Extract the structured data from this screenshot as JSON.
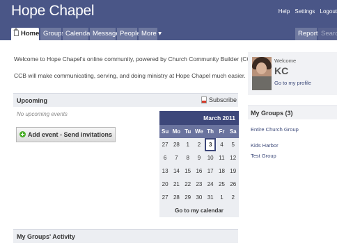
{
  "header": {
    "app_title": "Hope Chapel",
    "util_links": [
      "Help",
      "Settings",
      "Logout"
    ]
  },
  "nav": {
    "home": "Home",
    "groups": "Groups",
    "calendar": "Calendar",
    "messages": "Messages",
    "people": "People",
    "more": "More ▾",
    "reports": "Reports",
    "search": "Search"
  },
  "intro": {
    "line1": "Welcome to Hope Chapel's online community, powered by Church Community Builder (CCB)!",
    "line2": "CCB will make communicating, serving, and doing ministry at Hope Chapel much easier."
  },
  "upcoming": {
    "title": "Upcoming",
    "subscribe": "Subscribe",
    "empty": "No upcoming events",
    "add_event": "Add event - Send invitations"
  },
  "calendar": {
    "month": "March 2011",
    "dows": [
      "Su",
      "Mo",
      "Tu",
      "We",
      "Th",
      "Fr",
      "Sa"
    ],
    "weeks": [
      [
        "27",
        "28",
        "1",
        "2",
        "3",
        "4",
        "5"
      ],
      [
        "6",
        "7",
        "8",
        "9",
        "10",
        "11",
        "12"
      ],
      [
        "13",
        "14",
        "15",
        "16",
        "17",
        "18",
        "19"
      ],
      [
        "20",
        "21",
        "22",
        "23",
        "24",
        "25",
        "26"
      ],
      [
        "27",
        "28",
        "29",
        "30",
        "31",
        "1",
        "2"
      ]
    ],
    "today": "3",
    "footer": "Go to my calendar"
  },
  "activity": {
    "title": "My Groups' Activity"
  },
  "profile": {
    "welcome": "Welcome",
    "initials": "KC",
    "link": "Go to my profile"
  },
  "my_groups": {
    "title": "My Groups (3)",
    "items": [
      "Entire Church Group",
      "Kids Harbor",
      "Test Group"
    ]
  },
  "colors": {
    "header_bg": "#4a5687",
    "tab_bg": "#6e789f",
    "calendar_header": "#3d477a",
    "link": "#3d4a7a"
  }
}
